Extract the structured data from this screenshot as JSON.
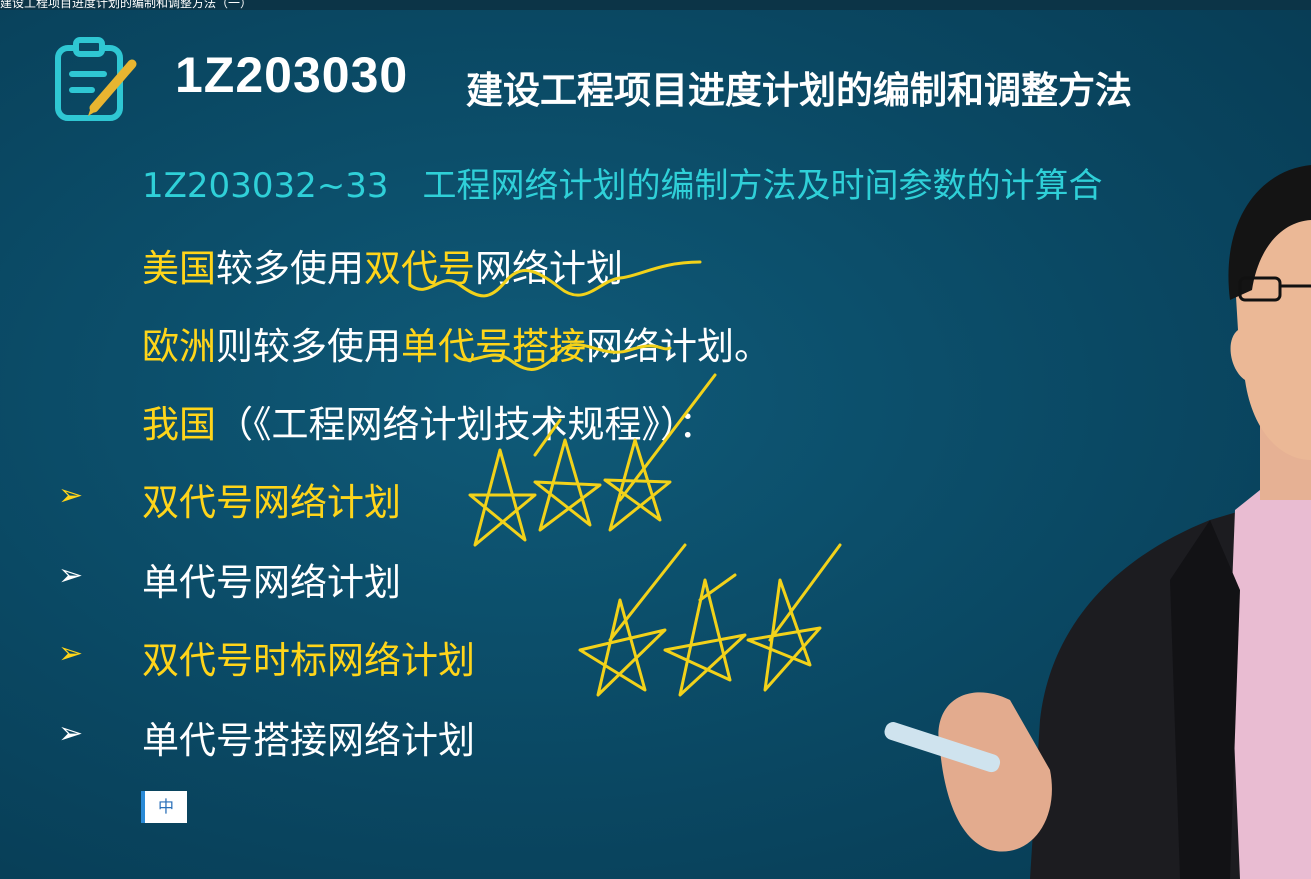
{
  "window_title": "建设工程项目进度计划的编制和调整方法（一）",
  "header": {
    "logo_icon": "notepad-pen-icon",
    "code": "1Z203030",
    "title": "建设工程项目进度计划的编制和调整方法"
  },
  "subtitle": "1Z203032~33　工程网络计划的编制方法及时间参数的计算合",
  "lines": {
    "line1": {
      "highlight": "美国",
      "text1": "较多使用",
      "highlight2": "双代号",
      "text2": "网络计划"
    },
    "line2": {
      "highlight": "欧洲",
      "text1": "则较多使用",
      "highlight2": "单代号搭接",
      "text2": "网络计划。"
    },
    "line3": {
      "highlight": "我国",
      "text1": "（《工程网络计划技术规程》）："
    }
  },
  "list": [
    {
      "bullet": "➢",
      "label": "双代号网络计划",
      "color": "#ffd51a"
    },
    {
      "bullet": "➢",
      "label": "单代号网络计划",
      "color": "#ffffff"
    },
    {
      "bullet": "➢",
      "label": "双代号时标网络计划",
      "color": "#ffd51a"
    },
    {
      "bullet": "➢",
      "label": "单代号搭接网络计划",
      "color": "#ffffff"
    }
  ],
  "input_badge": "中",
  "colors": {
    "background": "#0a4863",
    "highlight": "#ffd51a",
    "subtitle": "#2fd0d8",
    "ink": "#f2d21a"
  }
}
